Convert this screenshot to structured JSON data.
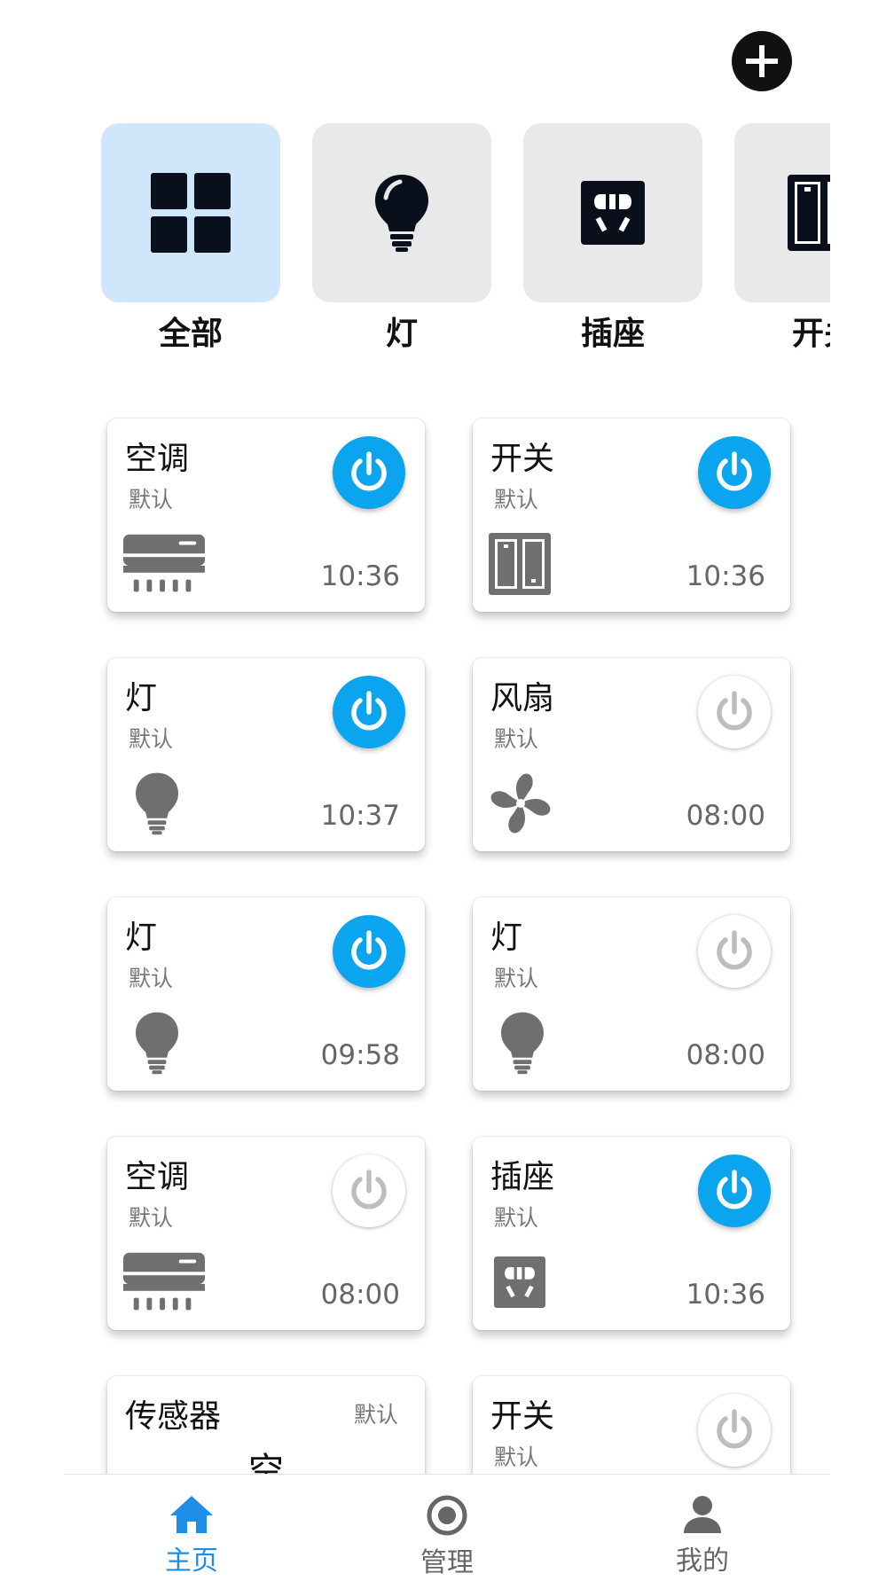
{
  "header": {
    "add_icon": "plus-circle-icon"
  },
  "categories": [
    {
      "label": "全部",
      "icon": "grid-icon",
      "active": true
    },
    {
      "label": "灯",
      "icon": "bulb-icon",
      "active": false
    },
    {
      "label": "插座",
      "icon": "socket-icon",
      "active": false
    },
    {
      "label": "开关",
      "icon": "switch-icon",
      "active": false
    }
  ],
  "devices": [
    {
      "name": "空调",
      "group": "默认",
      "time": "10:36",
      "icon": "ac-icon",
      "on": true
    },
    {
      "name": "开关",
      "group": "默认",
      "time": "10:36",
      "icon": "switch-icon",
      "on": true
    },
    {
      "name": "灯",
      "group": "默认",
      "time": "10:37",
      "icon": "bulb-icon",
      "on": true
    },
    {
      "name": "风扇",
      "group": "默认",
      "time": "08:00",
      "icon": "fan-icon",
      "on": false
    },
    {
      "name": "灯",
      "group": "默认",
      "time": "09:58",
      "icon": "bulb-icon",
      "on": true
    },
    {
      "name": "灯",
      "group": "默认",
      "time": "08:00",
      "icon": "bulb-icon",
      "on": false
    },
    {
      "name": "空调",
      "group": "默认",
      "time": "08:00",
      "icon": "ac-icon",
      "on": false
    },
    {
      "name": "插座",
      "group": "默认",
      "time": "10:36",
      "icon": "socket-icon",
      "on": true
    },
    {
      "name": "传感器",
      "group": "默认",
      "value": "空",
      "sensor": true
    },
    {
      "name": "开关",
      "group": "默认",
      "icon": "switch-icon",
      "on": false
    }
  ],
  "nav": [
    {
      "label": "主页",
      "icon": "home-icon",
      "active": true
    },
    {
      "label": "管理",
      "icon": "manage-icon",
      "active": false
    },
    {
      "label": "我的",
      "icon": "user-icon",
      "active": false
    }
  ],
  "colors": {
    "accent": "#0aa5ee",
    "nav_active": "#1c8ee8",
    "active_tile": "#d0e6fa",
    "tile": "#e9e9e9"
  }
}
